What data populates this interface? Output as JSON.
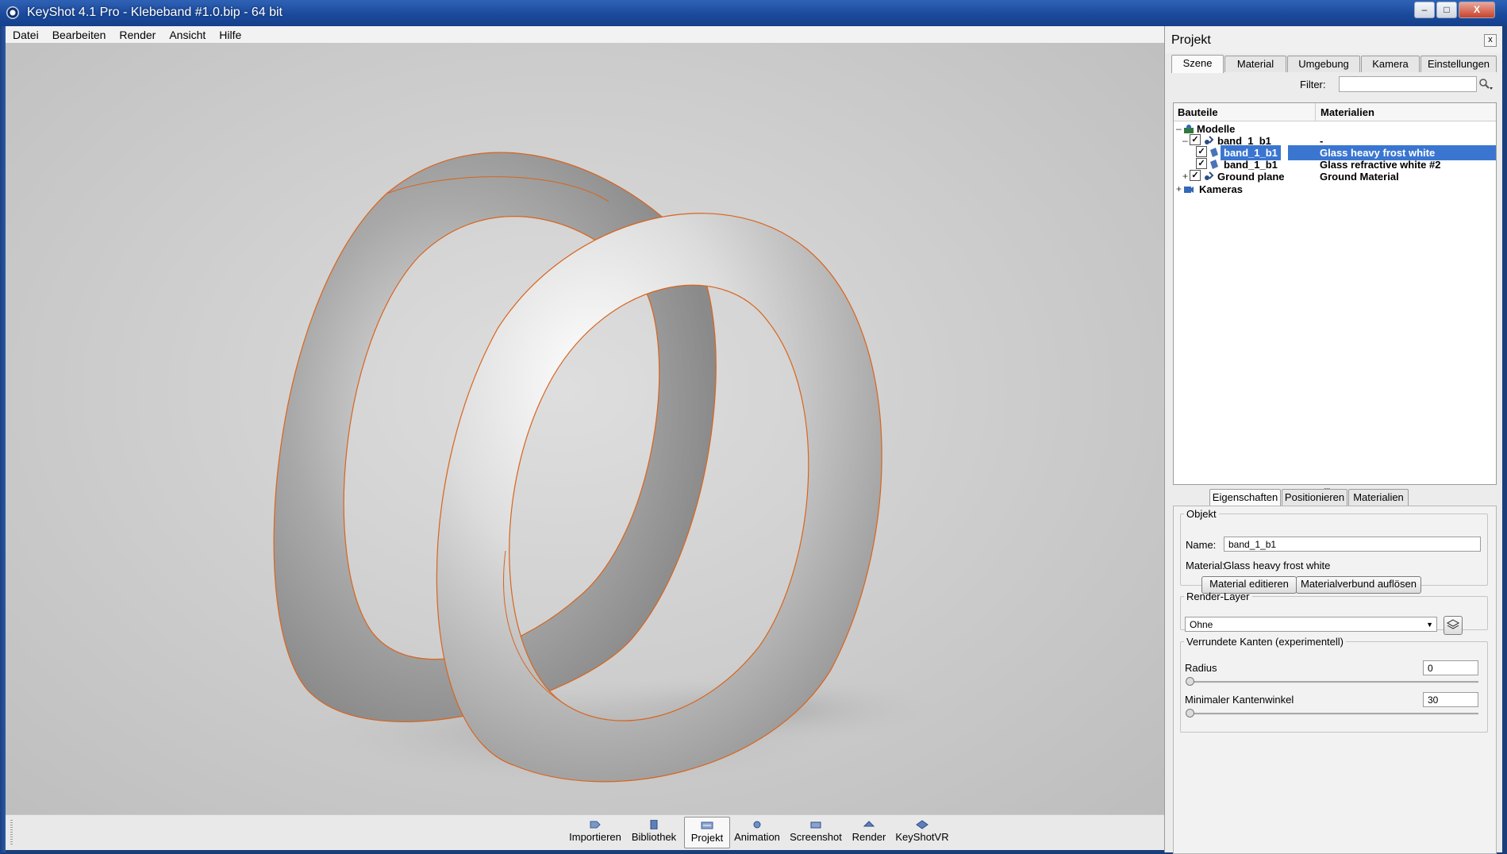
{
  "window": {
    "title": "KeyShot 4.1 Pro - Klebeband #1.0.bip - 64 bit",
    "minimize": "–",
    "maximize": "□",
    "close": "X"
  },
  "menu": [
    "Datei",
    "Bearbeiten",
    "Render",
    "Ansicht",
    "Hilfe"
  ],
  "toolbar": {
    "buttons": [
      {
        "label": "Importieren",
        "icon": "import-icon"
      },
      {
        "label": "Bibliothek",
        "icon": "library-icon"
      },
      {
        "label": "Projekt",
        "icon": "project-icon",
        "active": true
      },
      {
        "label": "Animation",
        "icon": "animation-icon"
      },
      {
        "label": "Screenshot",
        "icon": "screenshot-icon"
      },
      {
        "label": "Render",
        "icon": "render-icon"
      },
      {
        "label": "KeyShotVR",
        "icon": "keyshotvr-icon"
      }
    ]
  },
  "panel": {
    "title": "Projekt",
    "close": "x",
    "tabs": [
      "Szene",
      "Material",
      "Umgebung",
      "Kamera",
      "Einstellungen"
    ],
    "active_tab": "Szene",
    "filter_label": "Filter:",
    "filter_value": "",
    "tree": {
      "col_parts": "Bauteile",
      "col_materials": "Materialien",
      "rows": [
        {
          "expander": "–",
          "name": "Modelle",
          "material": "",
          "checked": null
        },
        {
          "expander": "–",
          "name": "band_1_b1",
          "material": "-",
          "checked": true
        },
        {
          "expander": "",
          "name": "band_1_b1",
          "material": "Glass heavy frost white",
          "checked": true,
          "selected": true
        },
        {
          "expander": "",
          "name": "band_1_b1",
          "material": "Glass refractive white #2",
          "checked": true
        },
        {
          "expander": "+",
          "name": "Ground plane",
          "material": "Ground Material",
          "checked": true
        },
        {
          "expander": "+",
          "name": "Kameras",
          "material": "",
          "checked": null
        }
      ]
    },
    "splitter": "•••",
    "prop_tabs": [
      "Eigenschaften",
      "Positionieren",
      "Materialien"
    ],
    "active_prop_tab": "Eigenschaften",
    "object": {
      "legend": "Objekt",
      "name_label": "Name:",
      "name_value": "band_1_b1",
      "material_label": "Material:",
      "material_value": "Glass heavy frost white",
      "edit_button": "Material editieren",
      "unlink_button": "Materialverbund auflösen"
    },
    "render_layer": {
      "legend": "Render-Layer",
      "value": "Ohne"
    },
    "edges": {
      "legend": "Verrundete Kanten (experimentell)",
      "radius_label": "Radius",
      "radius_value": "0",
      "radius_level": 0,
      "angle_label": "Minimaler Kantenwinkel",
      "angle_value": "30",
      "angle_level": 0
    }
  },
  "colors": {
    "selection": "#3a76d0",
    "outline": "#d9641c",
    "titlebar": "#1b4a9c"
  }
}
